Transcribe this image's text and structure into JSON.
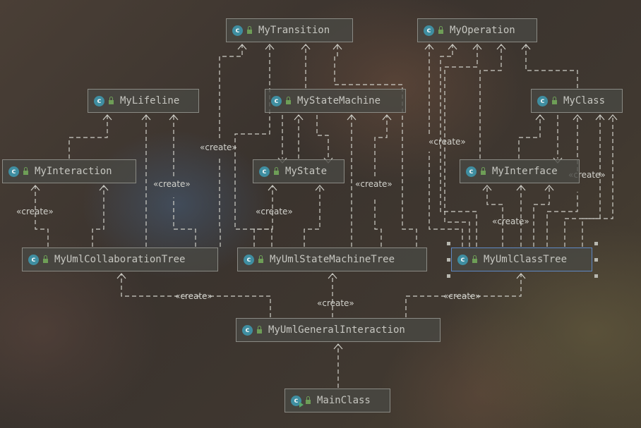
{
  "classes": [
    {
      "id": "MyTransition",
      "name": "MyTransition",
      "icon": "class-icon"
    },
    {
      "id": "MyOperation",
      "name": "MyOperation",
      "icon": "class-icon"
    },
    {
      "id": "MyLifeline",
      "name": "MyLifeline",
      "icon": "class-icon"
    },
    {
      "id": "MyStateMachine",
      "name": "MyStateMachine",
      "icon": "class-icon"
    },
    {
      "id": "MyClass",
      "name": "MyClass",
      "icon": "class-icon"
    },
    {
      "id": "MyInteraction",
      "name": "MyInteraction",
      "icon": "class-icon"
    },
    {
      "id": "MyState",
      "name": "MyState",
      "icon": "class-icon"
    },
    {
      "id": "MyInterface",
      "name": "MyInterface",
      "icon": "class-icon"
    },
    {
      "id": "MyUmlCollaborationTree",
      "name": "MyUmlCollaborationTree",
      "icon": "class-icon"
    },
    {
      "id": "MyUmlStateMachineTree",
      "name": "MyUmlStateMachineTree",
      "icon": "class-icon"
    },
    {
      "id": "MyUmlClassTree",
      "name": "MyUmlClassTree",
      "icon": "class-icon",
      "selected": true
    },
    {
      "id": "MyUmlGeneralInteraction",
      "name": "MyUmlGeneralInteraction",
      "icon": "class-icon"
    },
    {
      "id": "MainClass",
      "name": "MainClass",
      "icon": "runnable-class-icon"
    }
  ],
  "edge_labels": [
    "«create»",
    "«create»",
    "«create»",
    "«create»",
    "«create»",
    "«create»",
    "«create»",
    "«create»",
    "«create»",
    "«create»",
    "«create»"
  ],
  "colors": {
    "node_border": "#8a8a84",
    "selected_border": "#5f88c4",
    "class_icon": "#3f8ea1",
    "lock_icon": "#6e9e57",
    "edge": "#cfcfc8"
  }
}
